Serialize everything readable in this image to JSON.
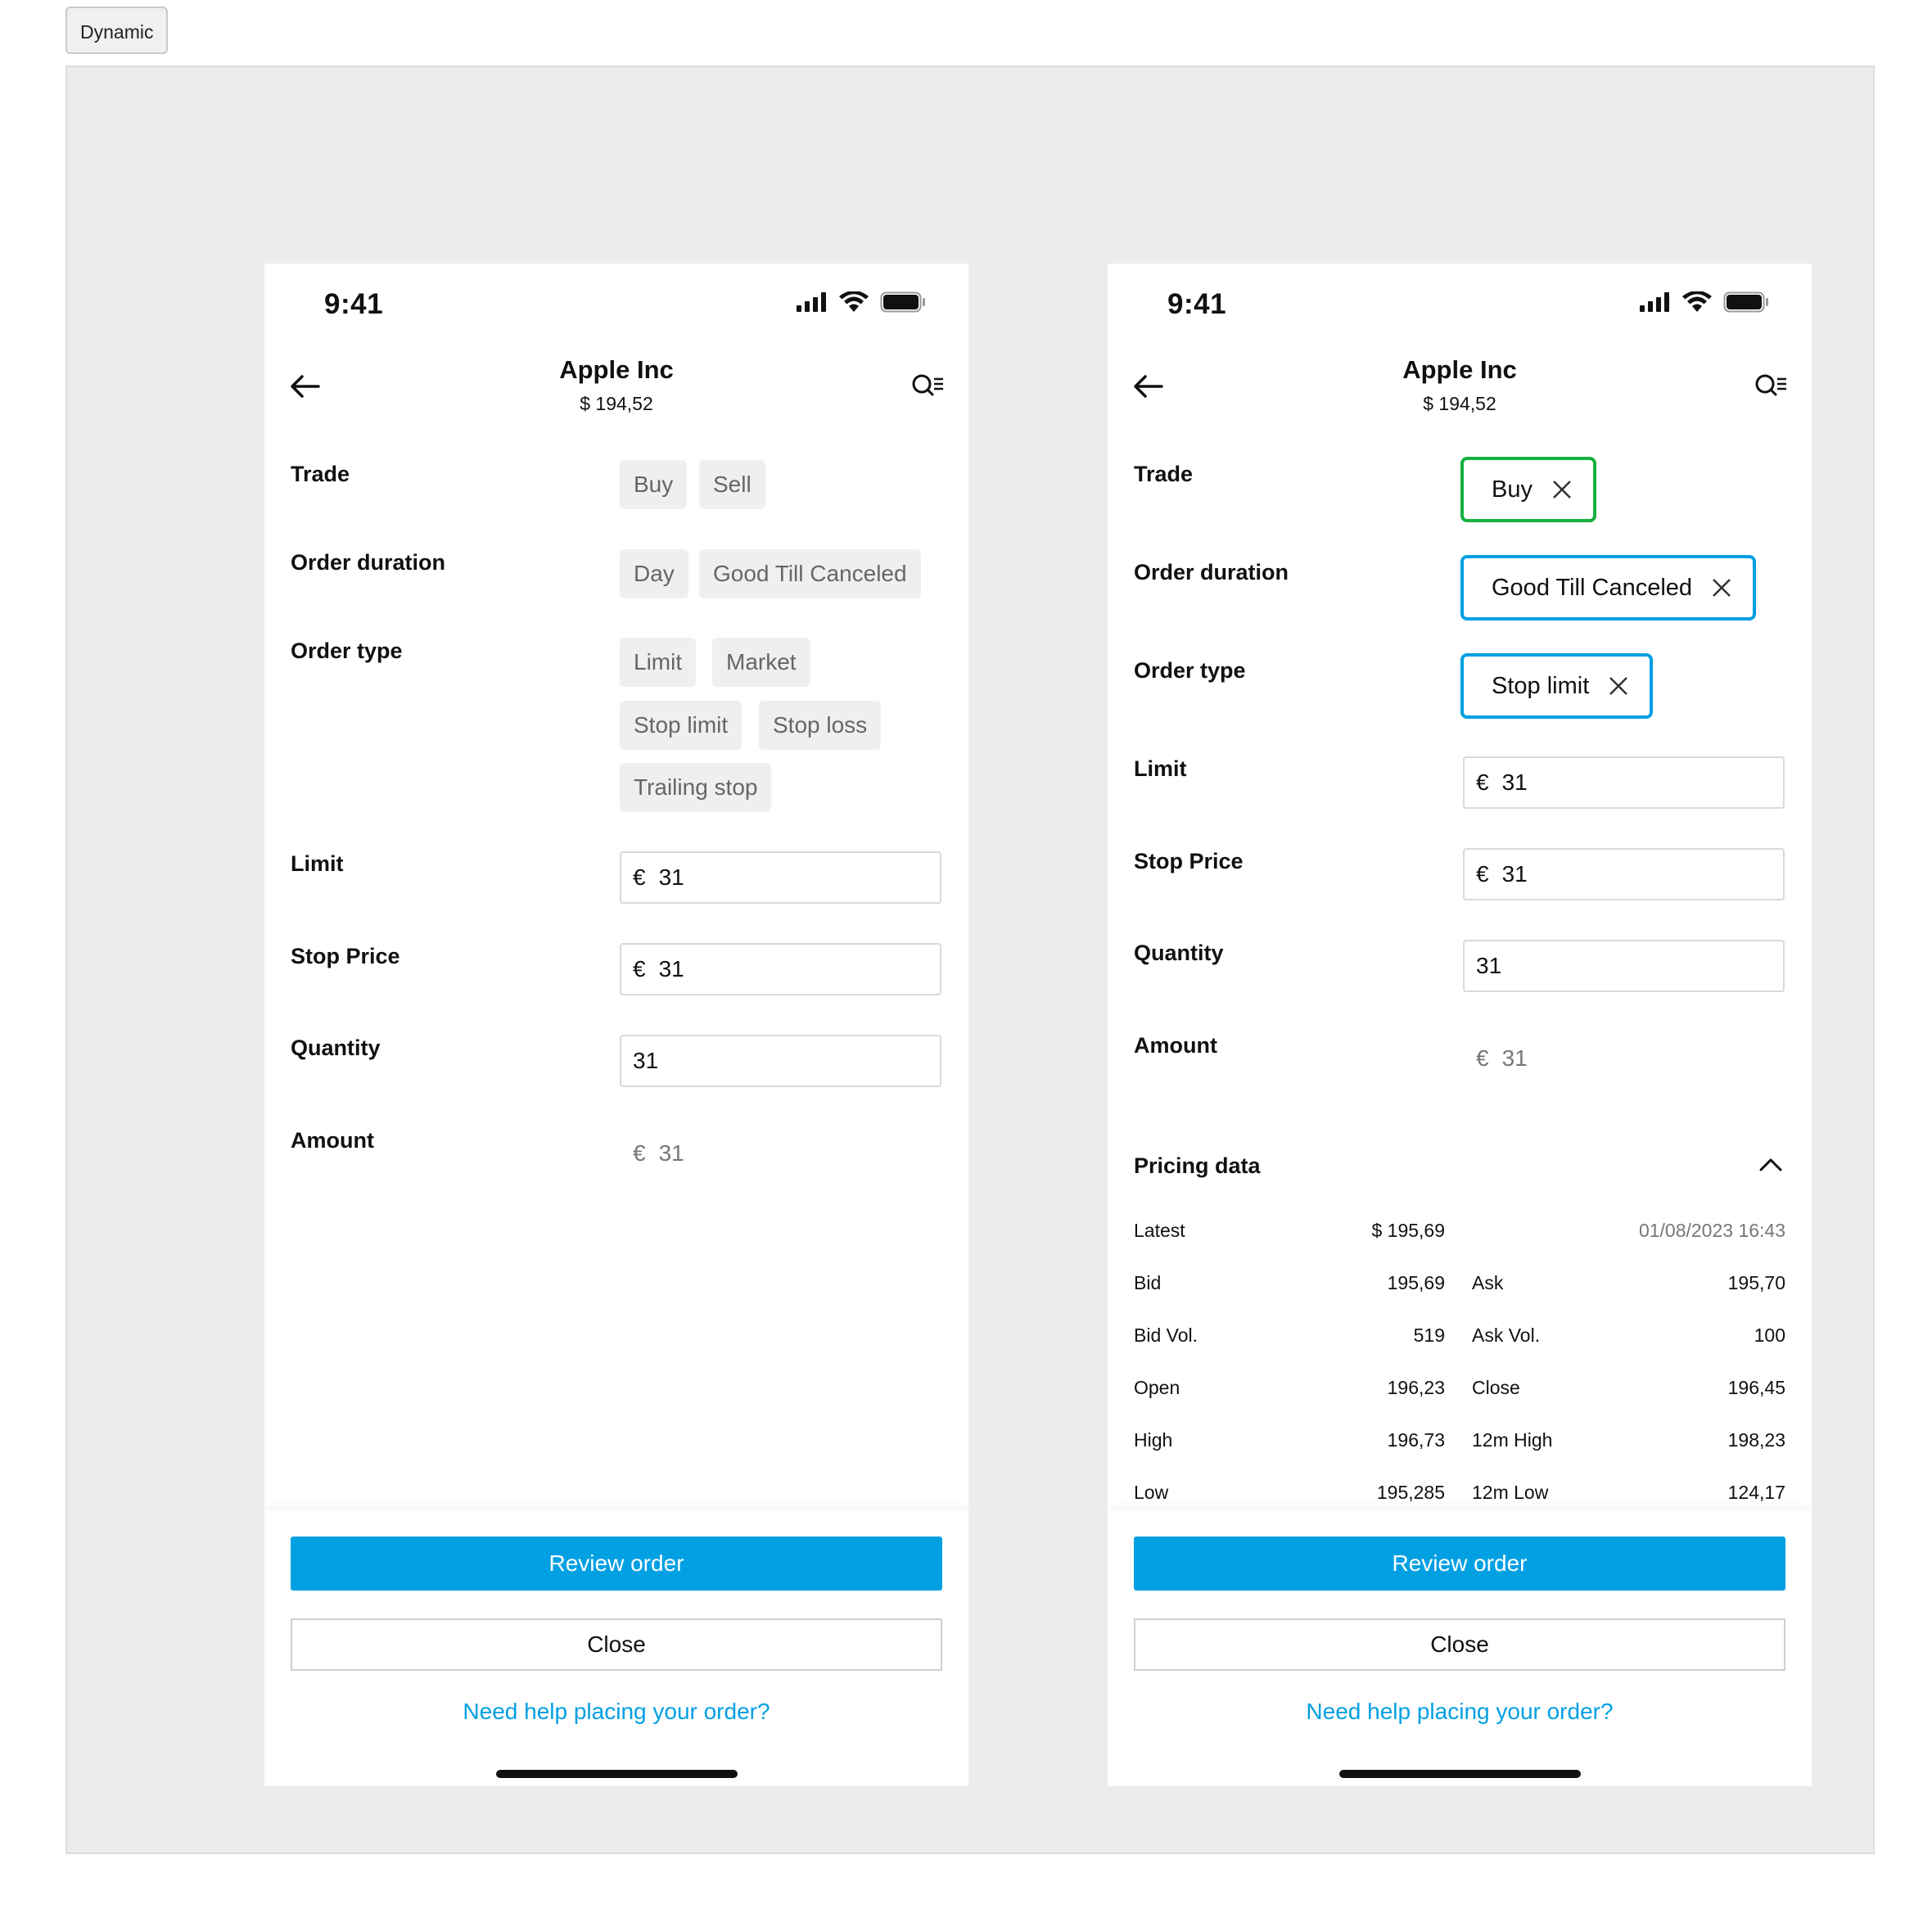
{
  "tag_label": "Dynamic",
  "left": {
    "status_time": "9:41",
    "title": "Apple Inc",
    "price": "$ 194,52",
    "labels": {
      "trade": "Trade",
      "order_duration": "Order duration",
      "order_type": "Order type",
      "limit": "Limit",
      "stop_price": "Stop Price",
      "quantity": "Quantity",
      "amount": "Amount"
    },
    "trade_options": [
      "Buy",
      "Sell"
    ],
    "duration_options": [
      "Day",
      "Good Till Canceled"
    ],
    "order_type_options": [
      "Limit",
      "Market",
      "Stop limit",
      "Stop loss",
      "Trailing stop"
    ],
    "currency_symbol": "€",
    "limit_value": "31",
    "stop_price_value": "31",
    "quantity_value": "31",
    "amount_value": "31",
    "review_label": "Review order",
    "close_label": "Close",
    "help_link": "Need help placing your order?"
  },
  "right": {
    "status_time": "9:41",
    "title": "Apple Inc",
    "price": "$ 194,52",
    "labels": {
      "trade": "Trade",
      "order_duration": "Order duration",
      "order_type": "Order type",
      "limit": "Limit",
      "stop_price": "Stop Price",
      "quantity": "Quantity",
      "amount": "Amount"
    },
    "selected_trade": "Buy",
    "selected_duration": "Good Till Canceled",
    "selected_order_type": "Stop limit",
    "currency_symbol": "€",
    "limit_value": "31",
    "stop_price_value": "31",
    "quantity_value": "31",
    "amount_value": "31",
    "pricing": {
      "title": "Pricing data",
      "latest_label": "Latest",
      "latest_value": "$ 195,69",
      "timestamp": "01/08/2023 16:43",
      "rows": [
        {
          "l1": "Bid",
          "v1": "195,69",
          "l2": "Ask",
          "v2": "195,70"
        },
        {
          "l1": "Bid Vol.",
          "v1": "519",
          "l2": "Ask Vol.",
          "v2": "100"
        },
        {
          "l1": "Open",
          "v1": "196,23",
          "l2": "Close",
          "v2": "196,45"
        },
        {
          "l1": "High",
          "v1": "196,73",
          "l2": "12m High",
          "v2": "198,23"
        },
        {
          "l1": "Low",
          "v1": "195,285",
          "l2": "12m Low",
          "v2": "124,17"
        }
      ]
    },
    "review_label": "Review order",
    "close_label": "Close",
    "help_link": "Need help placing your order?"
  },
  "colors": {
    "primary": "#00a0e3",
    "selected_trade_border": "#14b03d",
    "selected_border": "#009fe3",
    "canvas_bg": "#ececec"
  }
}
